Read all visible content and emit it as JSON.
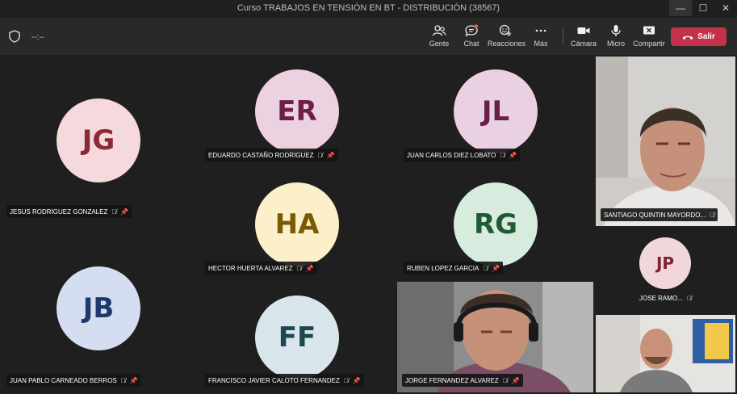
{
  "window": {
    "title": "Curso TRABAJOS EN TENSIÓN EN BT - DISTRIBUCIÓN (38567)",
    "minimize": "—",
    "maximize": "☐",
    "close": "✕"
  },
  "toolbar": {
    "timer": "--:--",
    "people": "Gente",
    "chat": "Chat",
    "reactions": "Reacciones",
    "more": "Más",
    "camera": "Cámara",
    "mic": "Micro",
    "share": "Compartir",
    "leave": "Salir"
  },
  "participants": [
    {
      "initials": "JG",
      "name": "JESUS RODRIGUEZ GONZALEZ",
      "bg": "#f5d9dc",
      "fg": "#8b2a35"
    },
    {
      "initials": "ER",
      "name": "EDUARDO CASTAÑO RODRIGUEZ",
      "bg": "#ecd1e1",
      "fg": "#6e1f46"
    },
    {
      "initials": "JL",
      "name": "JUAN CARLOS DIEZ LOBATO",
      "bg": "#e9d0e3",
      "fg": "#6a1e48"
    },
    {
      "initials": "HA",
      "name": "HECTOR HUERTA ALVAREZ",
      "bg": "#fbf0c9",
      "fg": "#7a5a06"
    },
    {
      "initials": "RG",
      "name": "RUBEN LOPEZ GARCIA",
      "bg": "#d7ecdf",
      "fg": "#1f5a33"
    },
    {
      "initials": "JB",
      "name": "JUAN PABLO CARNEADO BERROS",
      "bg": "#d4def0",
      "fg": "#1c3a6b"
    },
    {
      "initials": "FF",
      "name": "FRANCISCO JAVIER CALOTO FERNANDEZ",
      "bg": "#d8e6eb",
      "fg": "#1d4750"
    },
    {
      "initials": "JP",
      "name": "JOSE RAMO...",
      "bg": "#f1d6da",
      "fg": "#7e2431"
    }
  ],
  "video_participants": [
    {
      "name": "SANTIAGO QUINTIN MAYORDO..."
    },
    {
      "name": "JORGE FERNANDEZ ALVAREZ"
    },
    {
      "name": ""
    }
  ]
}
